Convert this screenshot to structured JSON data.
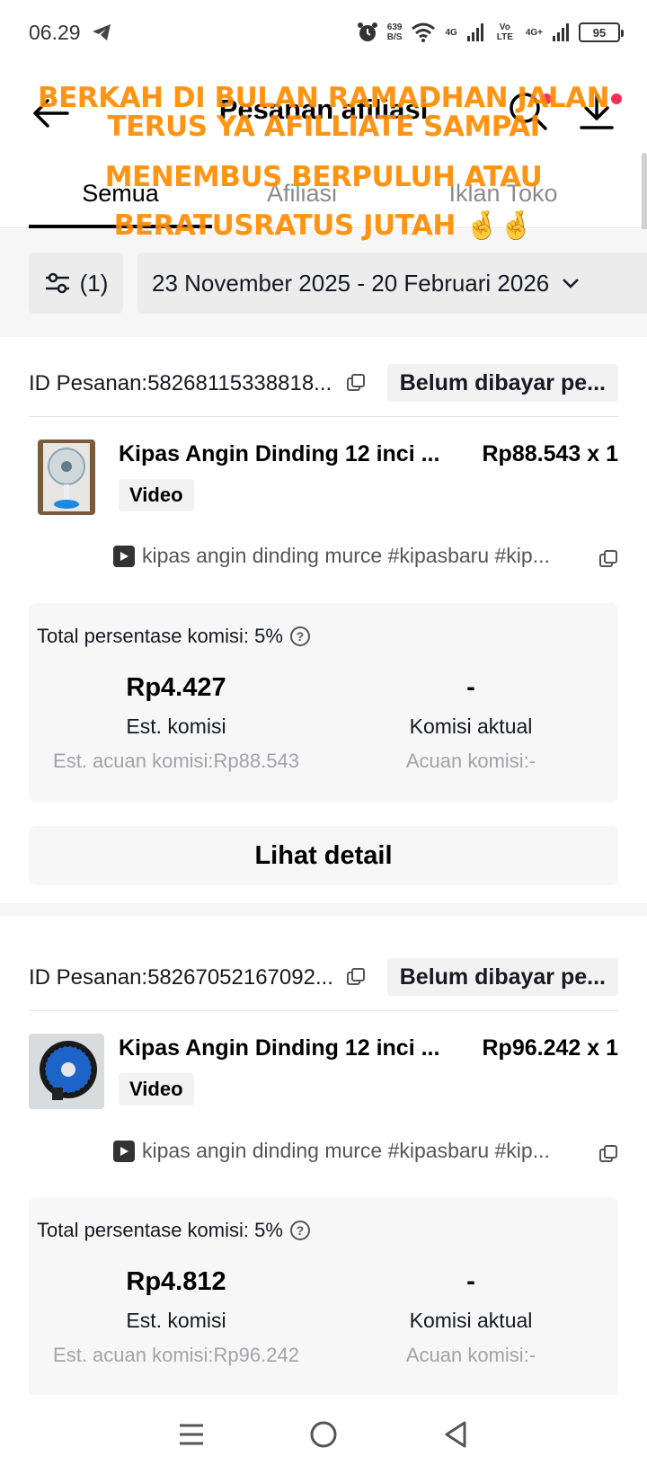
{
  "status_bar": {
    "time": "06.29",
    "net_speed_value": "639",
    "net_speed_unit": "B/S",
    "net1": "4G",
    "net2": "Vo LTE",
    "net3": "4G+",
    "battery": "95"
  },
  "header": {
    "title": "Pesanan afiliasi"
  },
  "tabs": [
    {
      "label": "Semua"
    },
    {
      "label": "Afiliasi"
    },
    {
      "label": "Iklan Toko"
    }
  ],
  "filter": {
    "count_label": "(1)",
    "date_range": "23 November 2025 - 20 Februari 2026"
  },
  "overlay": {
    "lines": [
      "BERKAH DI BULAN RAMADHAN JALAN",
      "TERUS YA AFILLIATE SAMPAI",
      "MENEMBUS BERPULUH ATAU",
      "BERATUSRATUS JUTAH 🤞🤞"
    ]
  },
  "orders": [
    {
      "order_id": "ID Pesanan:58268115338818...",
      "status": "Belum dibayar pe...",
      "product_name": "Kipas Angin Dinding 12 inci ...",
      "price": "Rp88.543 x 1",
      "tag": "Video",
      "video_title": "kipas angin dinding murce #kipasbaru #kip...",
      "commission_rate": "Total persentase komisi: 5%",
      "est_commission": "Rp4.427",
      "est_commission_label": "Est. komisi",
      "est_reference": "Est. acuan komisi:Rp88.543",
      "actual_commission": "-",
      "actual_commission_label": "Komisi aktual",
      "actual_reference": "Acuan komisi:-",
      "detail_label": "Lihat detail"
    },
    {
      "order_id": "ID Pesanan:58267052167092...",
      "status": "Belum dibayar pe...",
      "product_name": "Kipas Angin Dinding 12 inci ...",
      "price": "Rp96.242 x 1",
      "tag": "Video",
      "video_title": "kipas angin dinding murce #kipasbaru #kip...",
      "commission_rate": "Total persentase komisi: 5%",
      "est_commission": "Rp4.812",
      "est_commission_label": "Est. komisi",
      "est_reference": "Est. acuan komisi:Rp96.242",
      "actual_commission": "-",
      "actual_commission_label": "Komisi aktual",
      "actual_reference": "Acuan komisi:-"
    }
  ],
  "colors": {
    "overlay_text": "#ff8c00",
    "notification_dot": "#fe2c55",
    "card_background": "#f7f7f7"
  }
}
